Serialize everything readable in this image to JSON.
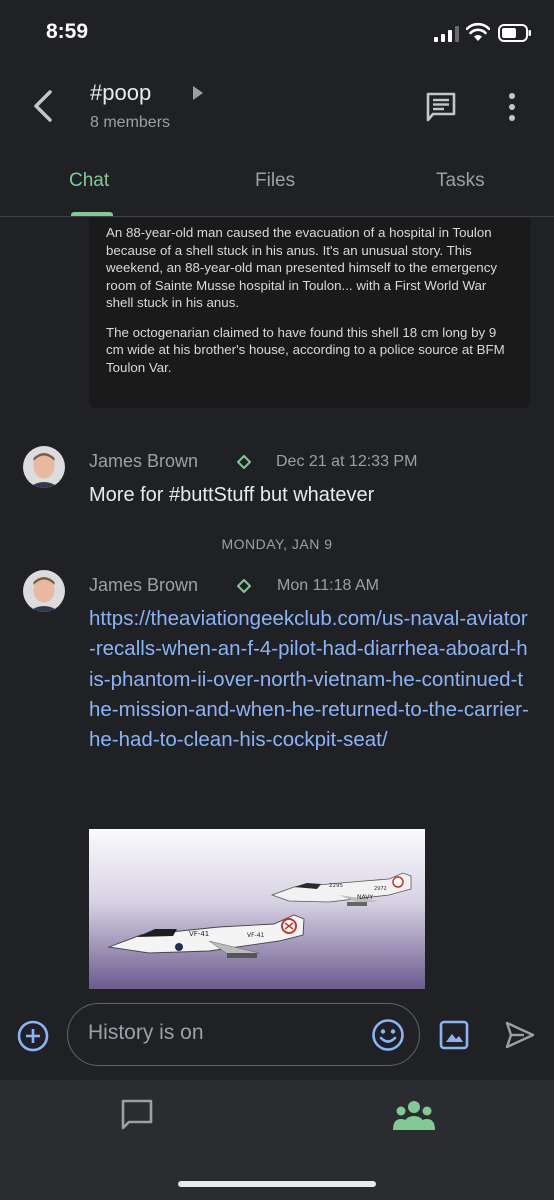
{
  "status": {
    "time": "8:59"
  },
  "header": {
    "title": "#poop",
    "subtitle": "8 members"
  },
  "tabs": [
    {
      "label": "Chat"
    },
    {
      "label": "Files"
    },
    {
      "label": "Tasks"
    }
  ],
  "article": {
    "paragraphs": [
      "An 88-year-old man caused the evacuation of a hospital in Toulon because of a shell stuck in his anus. It's an unusual story. This weekend, an 88-year-old man presented himself to the emergency room of Sainte Musse hospital in Toulon... with a First World War shell stuck in his anus.",
      "The octogenarian claimed to have found this shell 18 cm long by 9 cm wide at his brother's house, according to a police source at BFM Toulon Var."
    ]
  },
  "messages": [
    {
      "sender": "James Brown",
      "timestamp": "Dec 21 at 12:33 PM",
      "text": "More for #buttStuff but whatever"
    },
    {
      "sender": "James Brown",
      "timestamp": "Mon 11:18 AM",
      "link": "https://theaviationgeekclub.com/us-naval-aviator-recalls-when-an-f-4-pilot-had-diarrhea-aboard-his-phantom-ii-over-north-vietnam-he-continued-the-mission-and-when-he-returned-to-the-carrier-he-had-to-clean-his-cockpit-seat/"
    }
  ],
  "date_separator": "MONDAY, JAN 9",
  "preview_image": {
    "labels": [
      "VF-41",
      "2295",
      "VF-41",
      "2972",
      "NAVY"
    ]
  },
  "composer": {
    "placeholder": "History is on"
  },
  "colors": {
    "accent": "#81c995",
    "link": "#8ab4f8",
    "background": "#202124"
  },
  "icons": [
    "back-arrow-icon",
    "message-icon",
    "more-vert-icon",
    "add-icon",
    "emoji-icon",
    "image-icon",
    "send-icon",
    "chat-nav-icon",
    "people-nav-icon",
    "verified-diamond-icon"
  ]
}
